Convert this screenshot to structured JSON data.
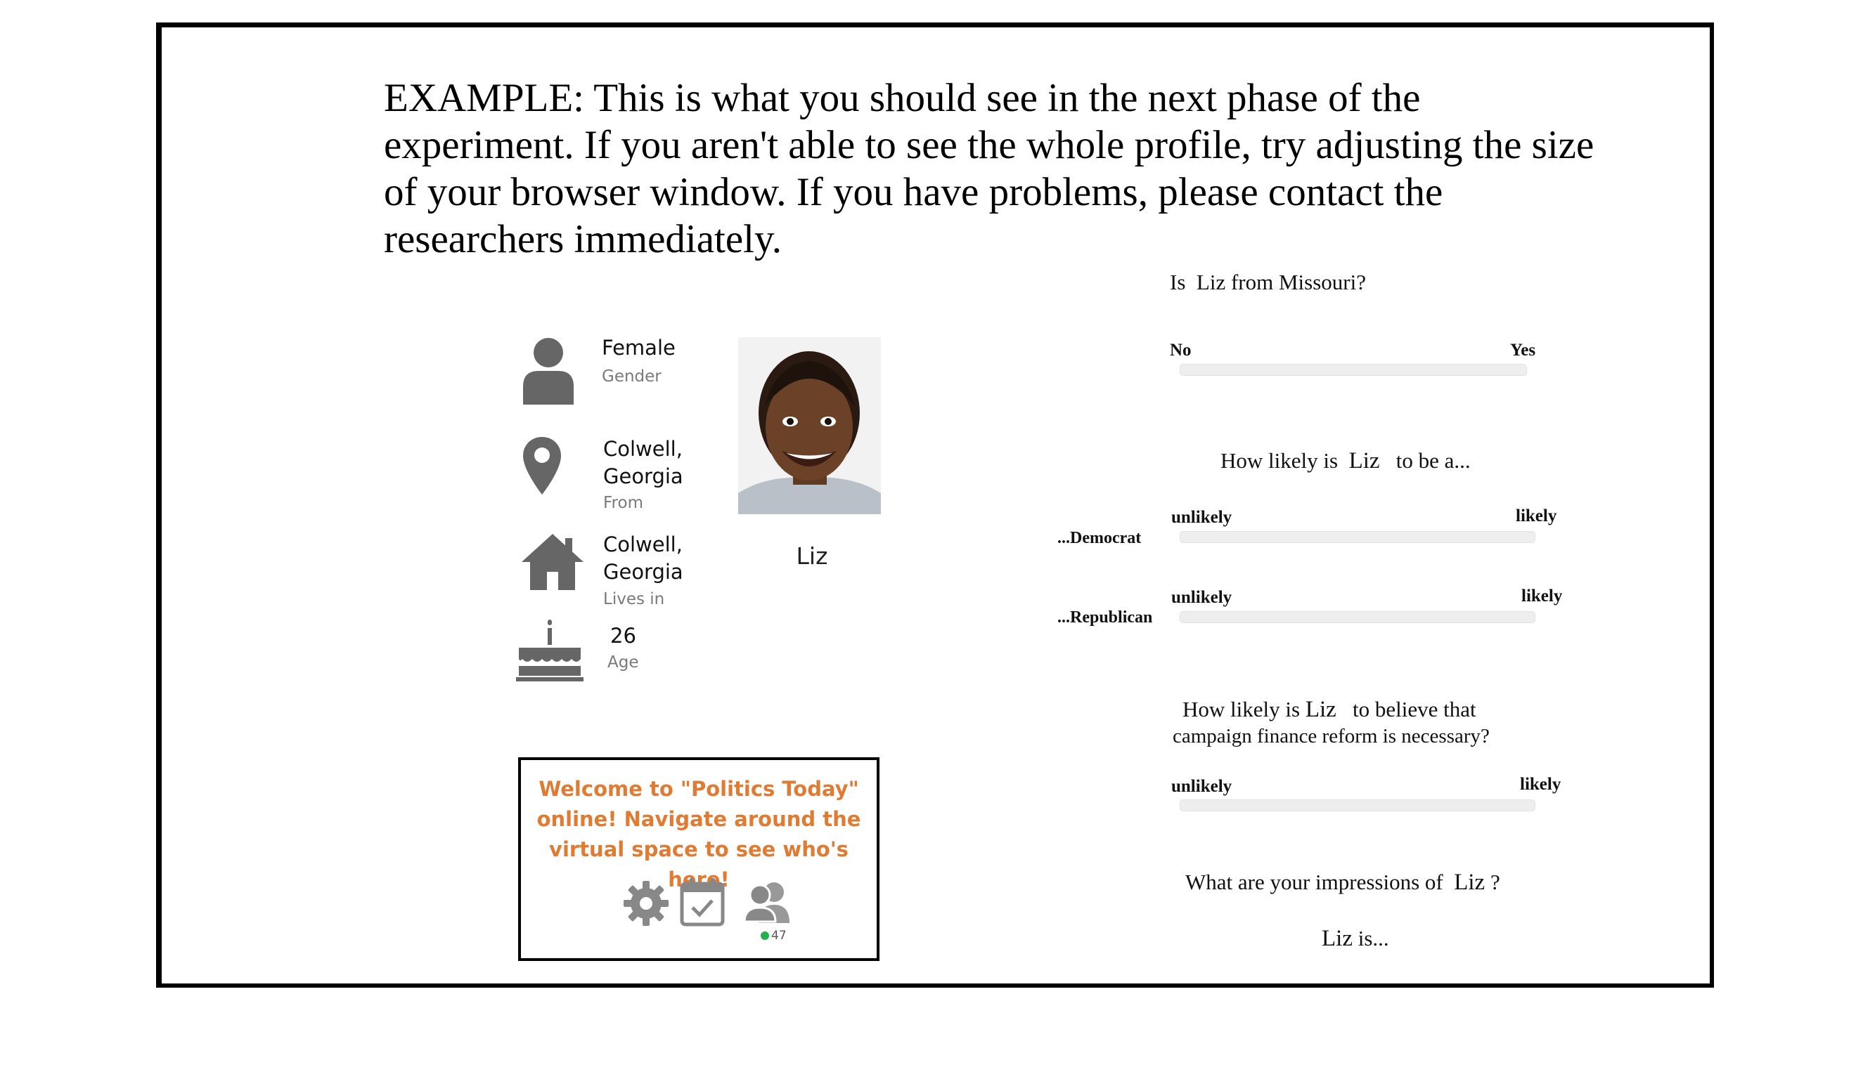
{
  "instructions": "EXAMPLE: This is what you should see in the next phase of the experiment. If you aren't able to see the whole profile, try adjusting the size of your browser window.  If you have problems, please contact the researchers immediately.",
  "profile": {
    "name": "Liz",
    "gender": {
      "icon": "person-icon",
      "value": "Female",
      "label": "Gender"
    },
    "from": {
      "icon": "location-pin-icon",
      "value": "Colwell, Georgia",
      "label": "From"
    },
    "lives_in": {
      "icon": "house-icon",
      "value": "Colwell, Georgia",
      "label": "Lives in"
    },
    "age": {
      "icon": "birthday-cake-icon",
      "value": "26",
      "label": "Age"
    }
  },
  "welcome": {
    "text": "Welcome to \"Politics Today\" online! Navigate around the virtual space to see who's here!",
    "online_count": "47",
    "online_color": "#22b14c",
    "accent_color": "#e07b33"
  },
  "questions": {
    "q1": {
      "pre": "Is",
      "name": "Liz",
      "post": "from Missouri?",
      "left": "No",
      "right": "Yes"
    },
    "q2": {
      "pre": "How likely is",
      "name": "Liz",
      "post": "to be a...",
      "democrat": "...Democrat",
      "republican": "...Republican",
      "left": "unlikely",
      "right": "likely"
    },
    "q3": {
      "pre": "How likely is",
      "name": "Liz",
      "post": "to believe that",
      "line2": "campaign finance reform is necessary?",
      "left": "unlikely",
      "right": "likely"
    },
    "q4": {
      "pre": "What are your impressions of",
      "name": "Liz",
      "post": "?"
    },
    "q5": {
      "name": "Liz",
      "post": "is..."
    }
  }
}
